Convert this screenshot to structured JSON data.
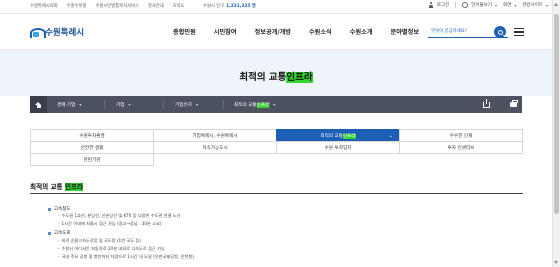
{
  "util_bar": {
    "links": [
      "수원특례시의회",
      "수원수목원",
      "수원시민발통복지서비스",
      "청사안내",
      "조직도"
    ],
    "population_label": "수원시 인구",
    "population_value": "1,231,325 명",
    "login_label": "로그인",
    "language_label": "언어불보기",
    "size_label": "화면",
    "sitemap_label": "관련사이트"
  },
  "header": {
    "logo_text": "수원특례시",
    "nav": [
      "종합민원",
      "시민참여",
      "정보공개/개방",
      "수원소식",
      "수원소개",
      "분야별정보"
    ],
    "search_placeholder": "무엇이 궁금하세요?"
  },
  "hero": {
    "title_prefix": "최적의 교통",
    "title_highlight": "인프라"
  },
  "breadcrumb": {
    "items": [
      "경제·기업",
      "기업",
      "기업유치",
      "최적의 교통"
    ],
    "last_highlight": "인프라"
  },
  "tabs": [
    {
      "label": "수원투자환경"
    },
    {
      "label": "기업특례시, 수원특례시"
    },
    {
      "label": "최적의 교통",
      "highlight": "인프라"
    },
    {
      "label": "우수한 인재"
    },
    {
      "label": "안전한 생활"
    },
    {
      "label": "지속가능도시"
    },
    {
      "label": "수원 투자입지"
    },
    {
      "label": "투자 인센티브"
    },
    {
      "label": "관련기관"
    }
  ],
  "content": {
    "title_prefix": "최적의 교통 ",
    "title_highlight": "인프라",
    "sections": [
      {
        "heading": "고속철도",
        "items": [
          "수도권 1호선, 분당선, 신분당선 및 KTX 등 다양한 수도권 연결 노선",
          "1시간 이내에 서울시 접근 가능 (광교→강남 : 30분 소요)"
        ]
      },
      {
        "heading": "고속도로",
        "items": [
          "외곽 순환고속도로망 및 국도망 (1번 국도 등)",
          "수원시 어디서든 자동차로 20분 내외로 고속도로 접근 가능",
          "국내 주요 공항 및 항만까지 차량으로 1시간 내 도달 (인천국제공항, 인천항)"
        ]
      }
    ]
  },
  "colors": {
    "primary": "#1d5fb5",
    "highlight": "#35d330",
    "breadcrumb_bg": "#4d5260",
    "hero_bg": "#eef4fa"
  }
}
